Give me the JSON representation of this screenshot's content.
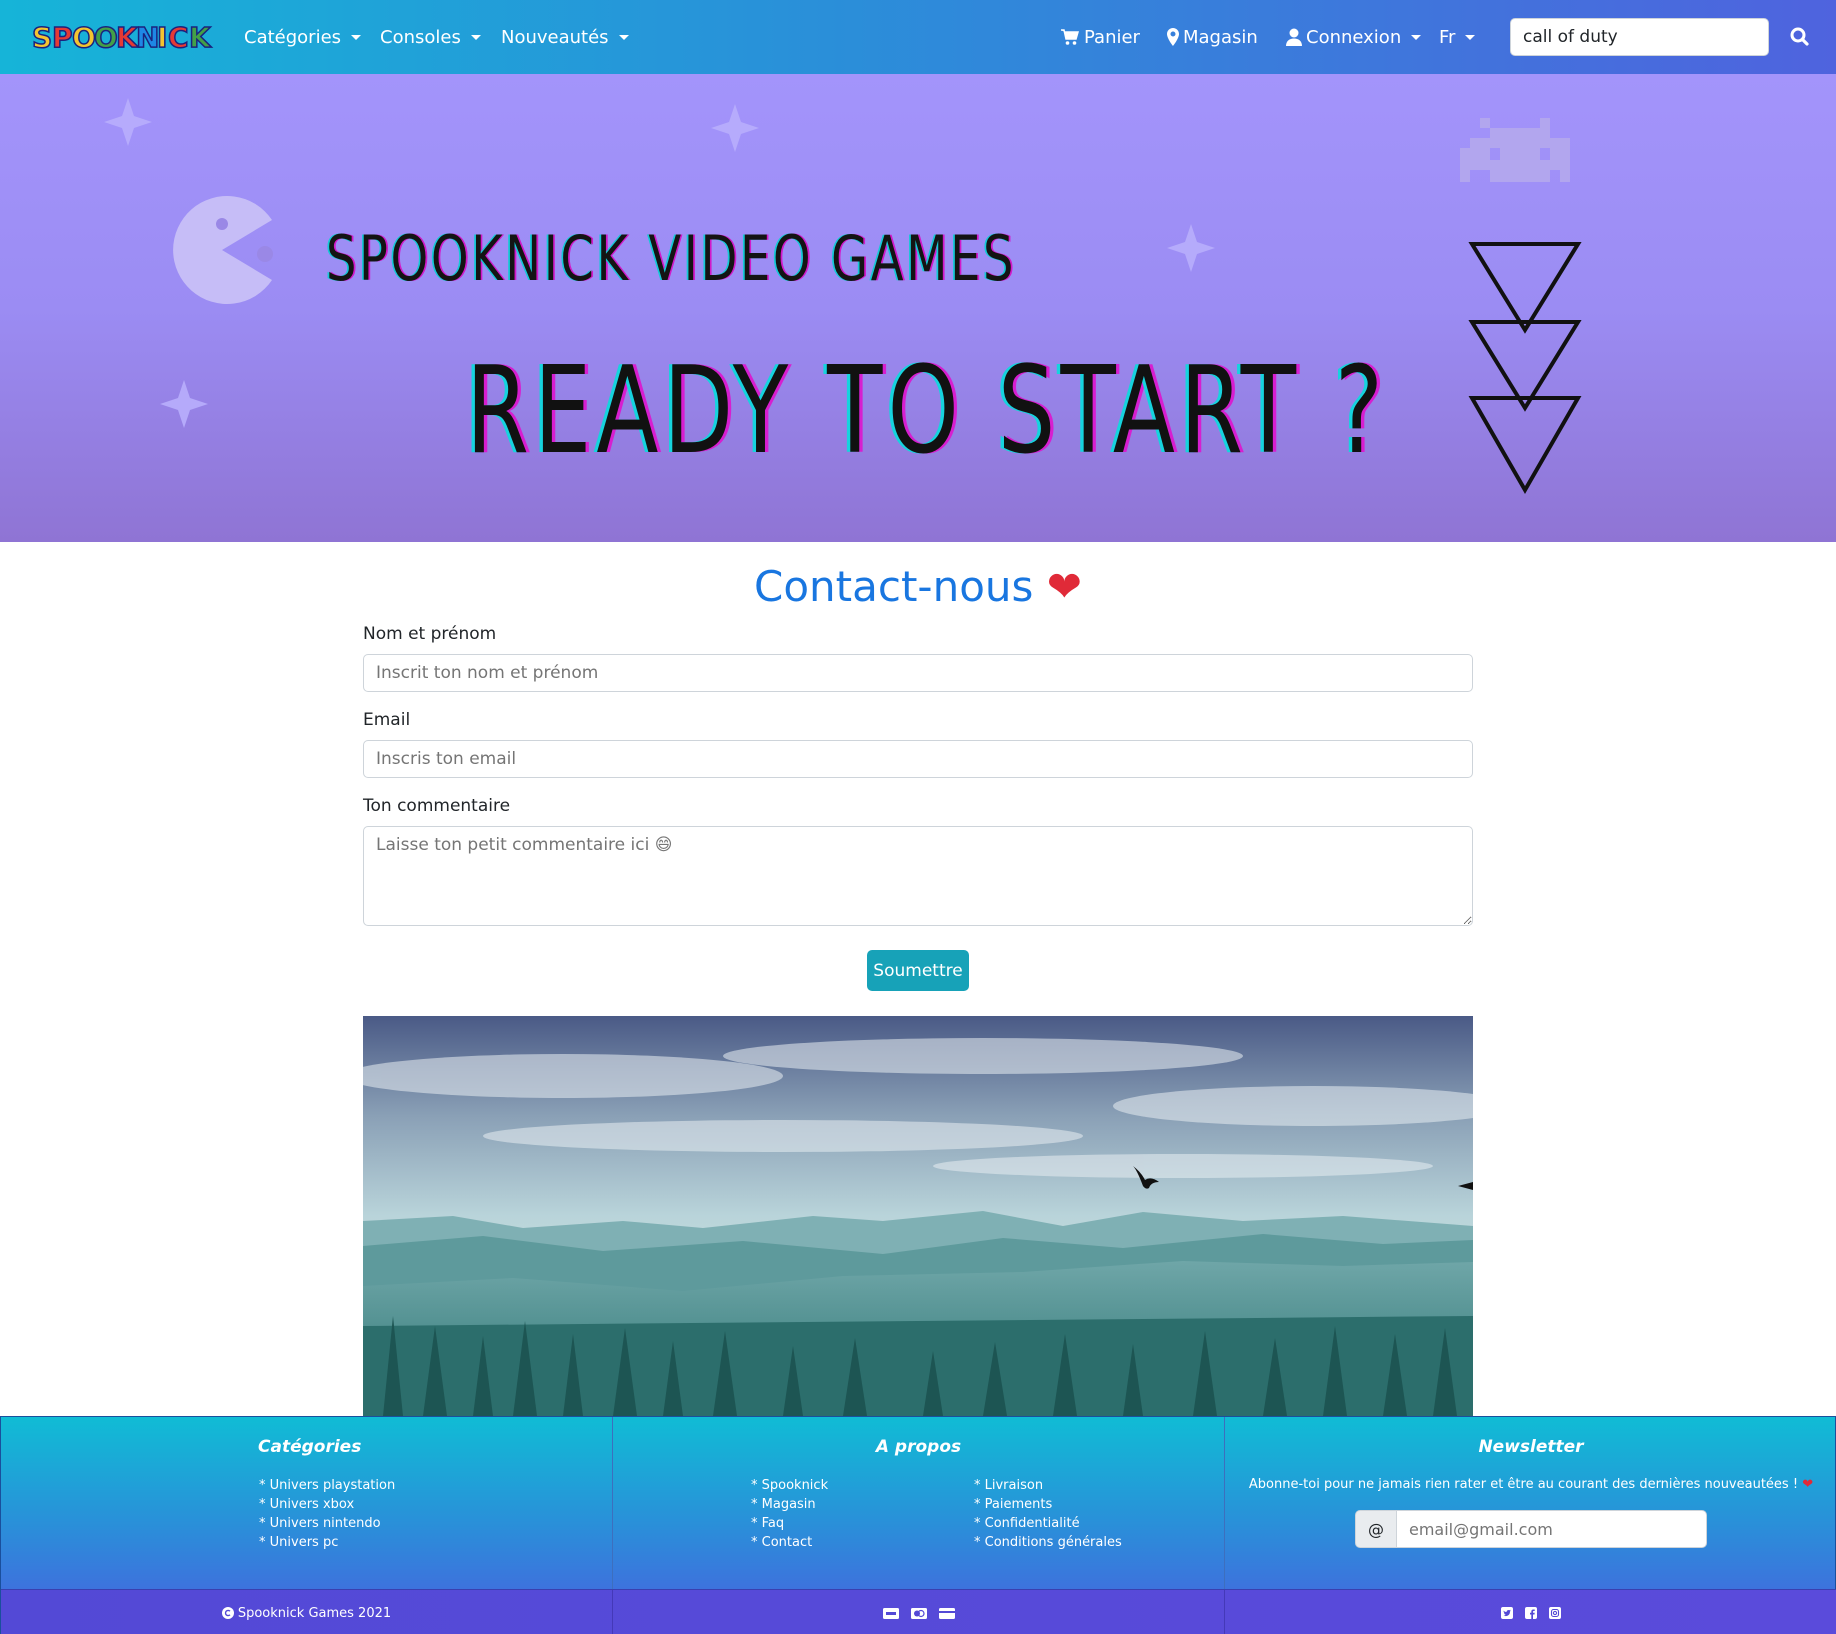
{
  "nav": {
    "brand": "SPOOKNICK",
    "categories": "Catégories",
    "consoles": "Consoles",
    "nouveautes": "Nouveautés",
    "panier": "Panier",
    "magasin": "Magasin",
    "connexion": "Connexion",
    "lang": "Fr",
    "search_value": "call of duty"
  },
  "hero": {
    "subtitle": "SPOOKNICK VIDEO GAMES",
    "title": "READY TO START ?"
  },
  "contact": {
    "title": "Contact-nous",
    "heart": "❤",
    "name_label": "Nom et prénom",
    "name_placeholder": "Inscrit ton nom et prénom",
    "email_label": "Email",
    "email_placeholder": "Inscris ton email",
    "comment_label": "Ton commentaire",
    "comment_placeholder": "Laisse ton petit commentaire ici 😄",
    "submit": "Soumettre"
  },
  "footer": {
    "categories": {
      "title": "Catégories",
      "items": [
        "* Univers playstation",
        "* Univers xbox",
        "* Univers nintendo",
        "* Univers pc"
      ]
    },
    "apropos": {
      "title": "A propos",
      "left": [
        "* Spooknick",
        "* Magasin",
        "* Faq",
        "* Contact"
      ],
      "right": [
        "* Livraison",
        "* Paiements",
        "* Confidentialité",
        "* Conditions générales"
      ]
    },
    "newsletter": {
      "title": "Newsletter",
      "text": "Abonne-toi pour ne jamais rien rater et être au courant des dernières nouveautées !",
      "heart": "❤",
      "at": "@",
      "placeholder": "email@gmail.com"
    },
    "copyright": "Spooknick Games 2021"
  },
  "colors": {
    "accent": "#1976e0",
    "button": "#17a2b8",
    "heart": "#e02a38"
  },
  "icons": [
    "cart-icon",
    "map-marker-icon",
    "user-icon",
    "search-icon",
    "copyright-icon",
    "visa-icon",
    "mastercard-icon",
    "credit-card-icon",
    "twitter-icon",
    "facebook-icon",
    "instagram-icon"
  ]
}
